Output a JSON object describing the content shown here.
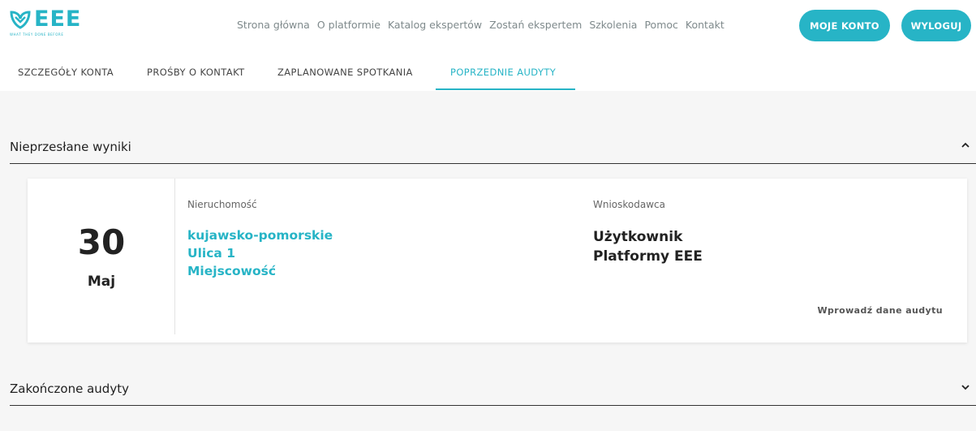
{
  "brand": {
    "name": "EEE",
    "tagline": "WHAT THEY DONE BEFORE",
    "accent_color": "#27b4c6",
    "logo_icon": "leaf-shield-icon"
  },
  "topnav": {
    "links": [
      "Strona główna",
      "O platformie",
      "Katalog ekspertów",
      "Zostań ekspertem",
      "Szkolenia",
      "Pomoc",
      "Kontakt"
    ],
    "account_button": "MOJE KONTO",
    "logout_button": "WYLOGUJ"
  },
  "tabs": {
    "items": [
      "SZCZEGÓŁY KONTA",
      "PROŚBY O KONTAKT",
      "ZAPLANOWANE SPOTKANIA",
      "POPRZEDNIE AUDYTY"
    ],
    "active_index": 3
  },
  "sections": {
    "pending": {
      "title": "Nieprzesłane wyniki",
      "expanded": true,
      "chevron_icon": "chevron-up-icon"
    },
    "completed": {
      "title": "Zakończone audyty",
      "expanded": false,
      "chevron_icon": "chevron-down-icon"
    }
  },
  "audit_card": {
    "day": "30",
    "month": "Maj",
    "property_label": "Nieruchomość",
    "property_lines": [
      "kujawsko-pomorskie",
      "Ulica 1",
      "Miejscowość"
    ],
    "applicant_label": "Wnioskodawca",
    "applicant_lines": [
      "Użytkownik",
      "Platformy EEE"
    ],
    "action_label": "Wprowadź dane audytu"
  }
}
